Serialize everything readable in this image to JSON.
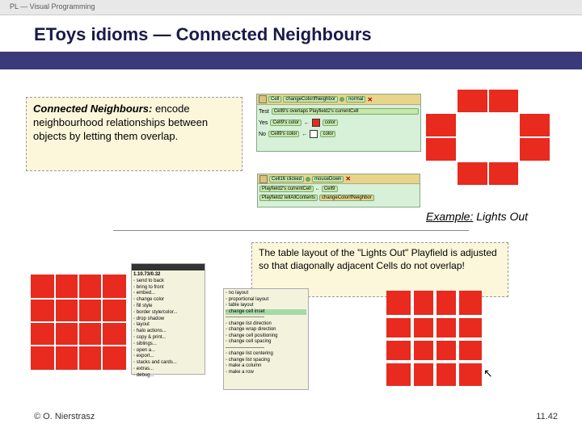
{
  "header": {
    "course": "PL — Visual Programming"
  },
  "title": "EToys idioms — Connected Neighbours",
  "box1": {
    "lead": "Connected Neighbours:",
    "body": " encode neighbourhood relationships between objects by letting them overlap."
  },
  "rwPattern": [
    [
      "w",
      "r",
      "r",
      "w"
    ],
    [
      "r",
      "w",
      "w",
      "r"
    ],
    [
      "r",
      "w",
      "w",
      "r"
    ],
    [
      "w",
      "r",
      "r",
      "w"
    ]
  ],
  "script1": {
    "barL": "Cell",
    "barName": "changeColorIfNeighbor",
    "mode": "normal",
    "testLabel": "Test",
    "testExpr": "Cell9's overlaps Playfield2's currentCell",
    "yes": "Yes",
    "yesL": "Cell9's color",
    "yesR": "color",
    "no": "No",
    "noL": "Cell9's color",
    "noR": "color"
  },
  "script2": {
    "barName": "Cell16  clicked",
    "mode": "mouseDown",
    "r1a": "Playfield2's currentCell",
    "r1b": "Cell9",
    "r2a": "Playfield2  tellAllContents",
    "r2b": "changeColorIfNeighbor"
  },
  "example": {
    "u": "Example:",
    "rest": " Lights Out"
  },
  "box2": "The table layout of the \"Lights Out\" Playfield is adjusted so that diagonally adjacent Cells do not overlap!",
  "list1": {
    "title": "1.10.73/0.32",
    "items": [
      "send to back",
      "bring to front",
      "embed...",
      "change color",
      "fill style",
      "border style/color...",
      "drop shadow",
      "layout",
      "halo actions...",
      "copy & print...",
      "siblings...",
      "open a...",
      "export...",
      "stacks and cards...",
      "extras...",
      "debug..."
    ]
  },
  "list2": {
    "items": [
      "no layout",
      "proportional layout",
      "table layout",
      "change cell inset",
      "------",
      "change list direction",
      "change wrap direction",
      "change cell positioning",
      "change cell spacing",
      "------",
      "change list centering",
      "change list spacing",
      "make a column",
      "make a row"
    ],
    "hl": "change cell inset"
  },
  "footer": {
    "left": "© O. Nierstrasz",
    "right": "11.42"
  }
}
